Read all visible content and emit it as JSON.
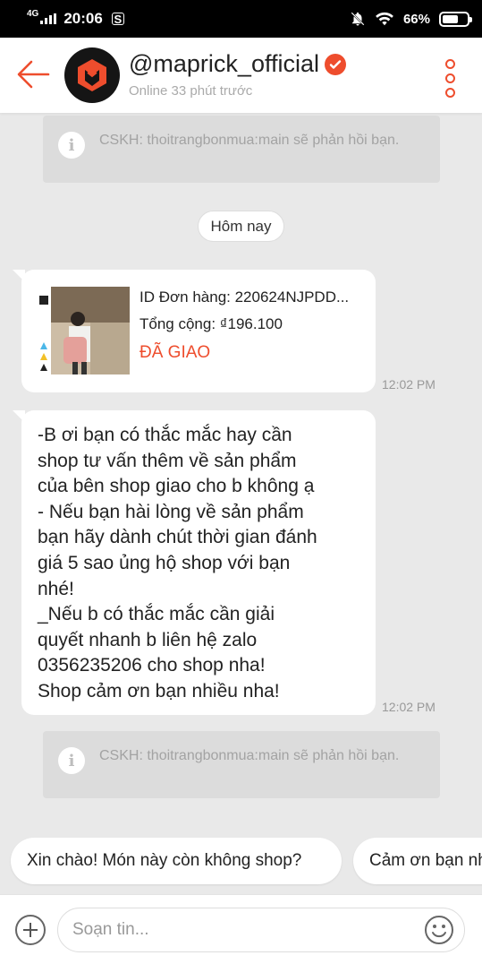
{
  "status_bar": {
    "network": "4G",
    "time": "20:06",
    "app_icon": "S",
    "battery": "66%",
    "battery_level": 0.66
  },
  "header": {
    "shop_name": "@maprick_official",
    "online_status": "Online 33 phút trước",
    "verified": true
  },
  "notices": [
    {
      "text": "CSKH: thoitrangbonmua:main sẽ phản hồi bạn."
    },
    {
      "text": "CSKH: thoitrangbonmua:main sẽ phản hồi bạn."
    }
  ],
  "date_separator": "Hôm nay",
  "order_card": {
    "order_id": "ID Đơn hàng: 220624NJPDD...",
    "total": "Tổng cộng: ₫196.100",
    "status": "ĐÃ GIAO",
    "time": "12:02 PM"
  },
  "message": {
    "lines": [
      "-B ơi bạn có thắc mắc hay cần",
      "shop tư vấn thêm về sản phẩm",
      "của bên shop giao cho b không ạ",
      "- Nếu bạn hài lòng về sản phẩm",
      "bạn hãy dành chút thời gian đánh",
      "giá 5 sao ủng hộ shop với bạn",
      "nhé!",
      "_Nếu b có thắc mắc cần giải",
      "quyết nhanh b liên hệ zalo",
      "0356235206 cho shop nha!",
      "Shop cảm ơn bạn nhiều nha!"
    ],
    "time": "12:02 PM"
  },
  "quick_replies": [
    "Xin chào! Món này còn không shop?",
    "Cảm ơn bạn nh"
  ],
  "composer": {
    "placeholder": "Soạn tin..."
  },
  "colors": {
    "accent": "#ee4d2d",
    "background": "#e9e9e9"
  }
}
